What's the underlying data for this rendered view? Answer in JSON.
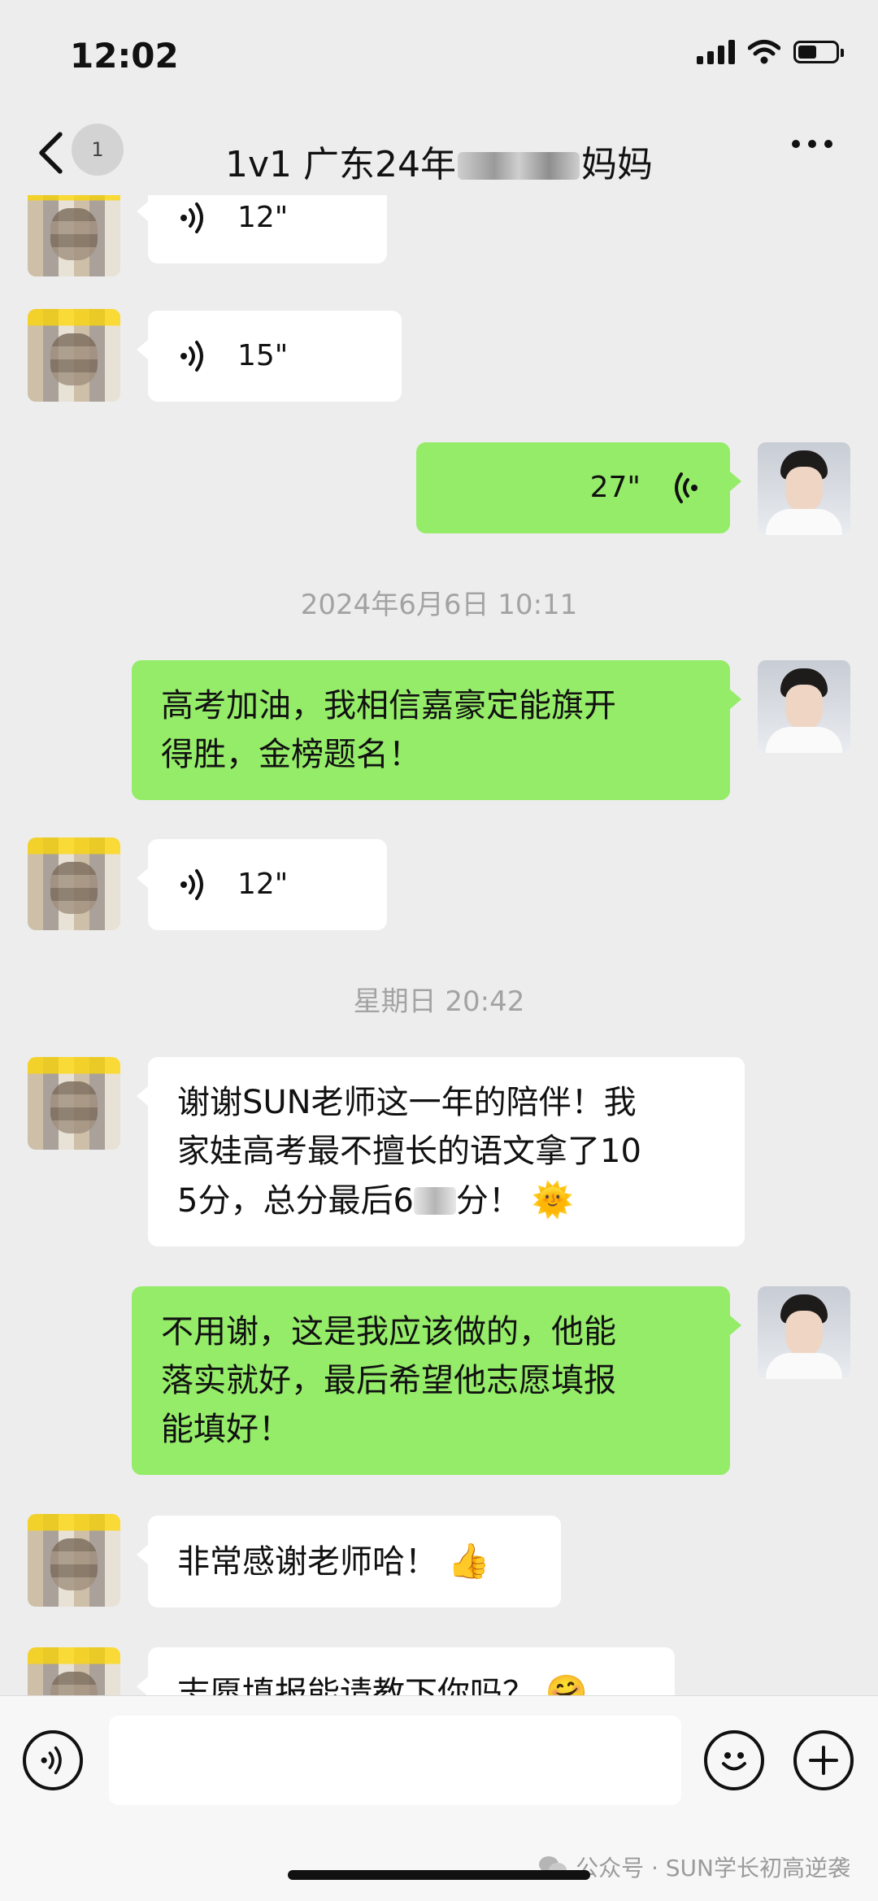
{
  "status_bar": {
    "time": "12:02"
  },
  "header": {
    "unread_badge": "1",
    "title_prefix": "1v1 广东24年",
    "title_suffix": "妈妈"
  },
  "messages": [
    {
      "from": "contact",
      "type": "voice",
      "duration": "12\""
    },
    {
      "from": "contact",
      "type": "voice",
      "duration": "15\""
    },
    {
      "from": "me",
      "type": "voice",
      "duration": "27\""
    },
    {
      "type": "timestamp",
      "text": "2024年6月6日 10:11"
    },
    {
      "from": "me",
      "type": "text",
      "line1": "高考加油，我相信嘉豪定能旗开",
      "line2": "得胜，金榜题名！"
    },
    {
      "from": "contact",
      "type": "voice",
      "duration": "12\""
    },
    {
      "type": "timestamp",
      "text": "星期日 20:42"
    },
    {
      "from": "contact",
      "type": "text",
      "line1": "谢谢SUN老师这一年的陪伴！我",
      "line2": "家娃高考最不擅长的语文拿了10",
      "line3_a": "5分，总分最后6",
      "line3_b": "分！",
      "emoji": "🌞"
    },
    {
      "from": "me",
      "type": "text",
      "line1": "不用谢，这是我应该做的，他能",
      "line2": "落实就好，最后希望他志愿填报",
      "line3": "能填好！"
    },
    {
      "from": "contact",
      "type": "text",
      "text": "非常感谢老师哈！",
      "emoji": "👍"
    },
    {
      "from": "contact",
      "type": "text",
      "text": "志愿填报能请教下你吗？",
      "emoji": "🤗"
    }
  ],
  "footer": {
    "watermark": "公众号 · SUN学长初高逆袭"
  }
}
